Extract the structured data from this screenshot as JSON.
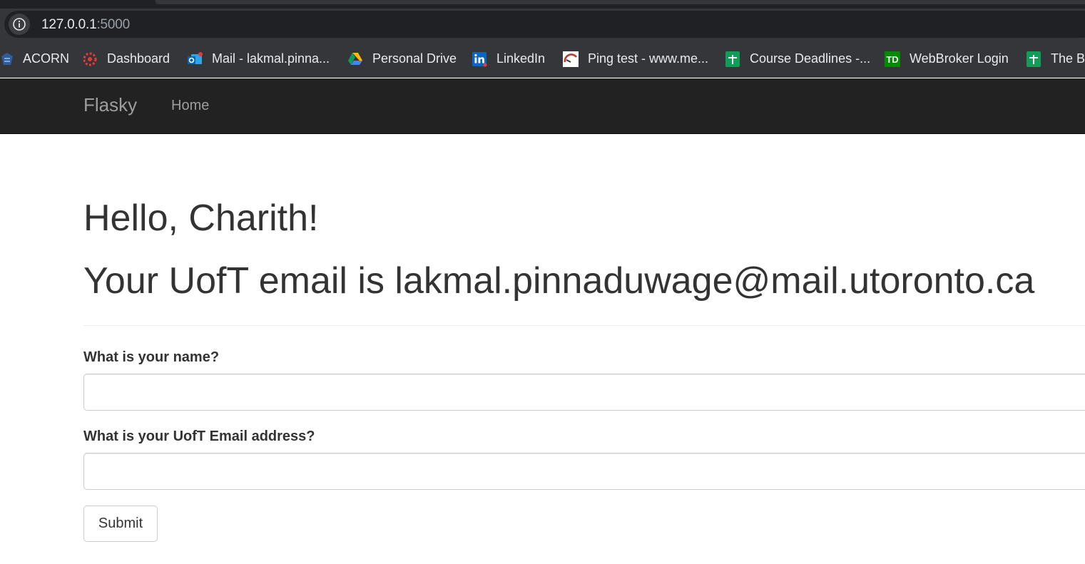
{
  "browser": {
    "url_host": "127.0.0.1",
    "url_port": ":5000",
    "bookmarks": [
      {
        "label": "ACORN",
        "icon": "acorn-icon"
      },
      {
        "label": "Dashboard",
        "icon": "dashboard-icon"
      },
      {
        "label": "Mail - lakmal.pinna...",
        "icon": "outlook-icon"
      },
      {
        "label": "Personal Drive",
        "icon": "google-drive-icon"
      },
      {
        "label": "LinkedIn",
        "icon": "linkedin-icon"
      },
      {
        "label": "Ping test - www.me...",
        "icon": "ping-icon"
      },
      {
        "label": "Course Deadlines -...",
        "icon": "sheets-icon"
      },
      {
        "label": "WebBroker Login",
        "icon": "td-icon"
      },
      {
        "label": "The Bo",
        "icon": "sheets-icon"
      }
    ]
  },
  "navbar": {
    "brand": "Flasky",
    "links": [
      {
        "label": "Home"
      }
    ]
  },
  "page": {
    "greeting": "Hello, Charith!",
    "email_line": "Your UofT email is lakmal.pinnaduwage@mail.utoronto.ca"
  },
  "form": {
    "name_label": "What is your name?",
    "name_value": "",
    "email_label": "What is your UofT Email address?",
    "email_value": "",
    "submit_label": "Submit"
  },
  "colors": {
    "navbar_bg": "#222222",
    "navbar_text": "#9d9d9d",
    "heading_text": "#333333",
    "chrome_bg": "#35363a"
  }
}
